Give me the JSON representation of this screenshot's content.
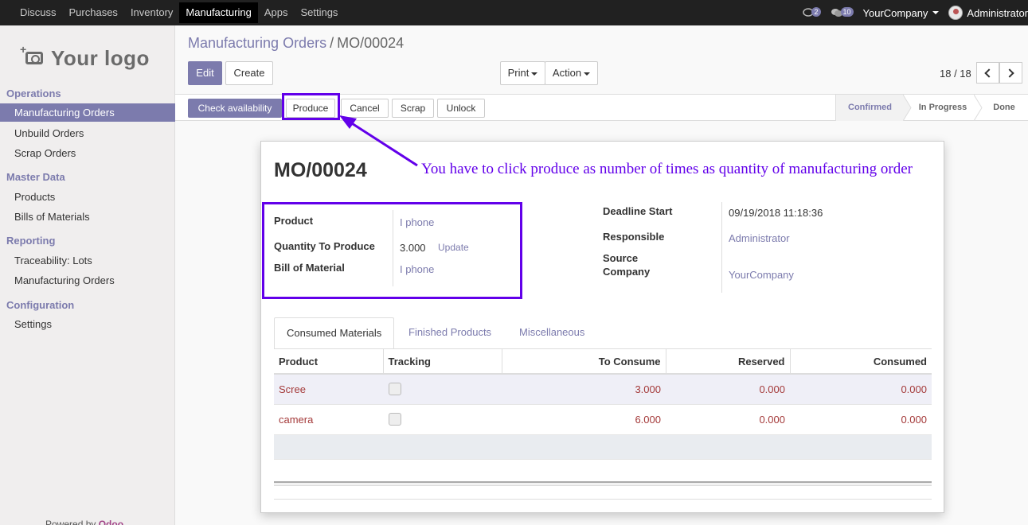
{
  "topbar": {
    "menu": [
      "Discuss",
      "Purchases",
      "Inventory",
      "Manufacturing",
      "Apps",
      "Settings"
    ],
    "active": "Manufacturing",
    "messages_count": "2",
    "activities_count": "10",
    "company": "YourCompany",
    "user": "Administrator"
  },
  "sidebar": {
    "logo_text": "Your logo",
    "sections": [
      {
        "title": "Operations",
        "items": [
          "Manufacturing Orders",
          "Unbuild Orders",
          "Scrap Orders"
        ]
      },
      {
        "title": "Master Data",
        "items": [
          "Products",
          "Bills of Materials"
        ]
      },
      {
        "title": "Reporting",
        "items": [
          "Traceability: Lots",
          "Manufacturing Orders"
        ]
      },
      {
        "title": "Configuration",
        "items": [
          "Settings"
        ]
      }
    ],
    "active_item": "Manufacturing Orders",
    "powered_by": "Powered by",
    "powered_brand": "Odoo"
  },
  "control": {
    "breadcrumb_parent": "Manufacturing Orders",
    "breadcrumb_sep": "/",
    "breadcrumb_current": "MO/00024",
    "edit": "Edit",
    "create": "Create",
    "print": "Print",
    "action": "Action",
    "pager": "18 / 18"
  },
  "statusbar": {
    "buttons": [
      "Check availability",
      "Produce",
      "Cancel",
      "Scrap",
      "Unlock"
    ],
    "stages": [
      "Confirmed",
      "In Progress",
      "Done"
    ],
    "active_stage": "Confirmed"
  },
  "form": {
    "title": "MO/00024",
    "product_label": "Product",
    "product": "I phone",
    "qty_label": "Quantity To Produce",
    "qty": "3.000",
    "update": "Update",
    "bom_label": "Bill of Material",
    "bom": "I phone",
    "deadline_label": "Deadline Start",
    "deadline": "09/19/2018 11:18:36",
    "responsible_label": "Responsible",
    "responsible": "Administrator",
    "source_label_1": "Source",
    "source_label_2": "Company",
    "source": "YourCompany"
  },
  "tabs": [
    "Consumed Materials",
    "Finished Products",
    "Miscellaneous"
  ],
  "table": {
    "headers": [
      "Product",
      "Tracking",
      "To Consume",
      "Reserved",
      "Consumed"
    ],
    "rows": [
      {
        "product": "Scree",
        "to_consume": "3.000",
        "reserved": "0.000",
        "consumed": "0.000"
      },
      {
        "product": "camera",
        "to_consume": "6.000",
        "reserved": "0.000",
        "consumed": "0.000"
      }
    ]
  },
  "annotation": {
    "text": "You have to click produce as number of times as quantity of manufacturing order",
    "color": "#6200ea"
  },
  "colors": {
    "accent": "#7c7bad",
    "topbar": "#212121",
    "line_text": "#a43a3a"
  }
}
